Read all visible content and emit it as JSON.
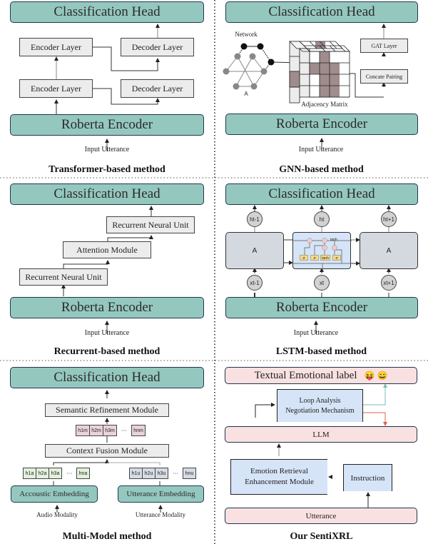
{
  "panels": {
    "transformer": {
      "head": "Classification Head",
      "encoder_layers": [
        "Encoder Layer",
        "Encoder Layer"
      ],
      "decoder_layers": [
        "Decoder Layer",
        "Decoder Layer"
      ],
      "base": "Roberta Encoder",
      "input": "Input Utterance",
      "caption": "Transformer-based method"
    },
    "gnn": {
      "head": "Classification Head",
      "network_label": "Network",
      "node_label": "A",
      "matrix_label": "Adjacency Matrix",
      "gat": "GAT Layer",
      "concat": "Concate Pairing",
      "base": "Roberta Encoder",
      "input": "Input Utterance",
      "caption": "GNN-based method"
    },
    "recurrent": {
      "head": "Classification Head",
      "top_unit": "Recurrent Neural Unit",
      "attention": "Attention Module",
      "bottom_unit": "Recurrent Neural Unit",
      "base": "Roberta Encoder",
      "input": "Input Utterance",
      "caption": "Recurrent-based method"
    },
    "lstm": {
      "head": "Classification Head",
      "outputs": [
        "ht-1",
        "ht",
        "ht+1"
      ],
      "cells": [
        "A",
        "",
        "A"
      ],
      "gates": [
        "σ",
        "σ",
        "tanh",
        "σ"
      ],
      "tanh_label": "tanh",
      "inputs": [
        "xt-1",
        "xt",
        "xt+1"
      ],
      "base": "Roberta Encoder",
      "input": "Input Utterance",
      "caption": "LSTM-based method"
    },
    "multimodal": {
      "head": "Classification Head",
      "semantic": "Semantic Refinement Module",
      "fused_tokens": [
        "h1m",
        "h2m",
        "h3m",
        "···",
        "hnm"
      ],
      "context": "Context Fusion Module",
      "audio_tokens": [
        "h1a",
        "h2a",
        "h3a",
        "···",
        "hna"
      ],
      "utter_tokens": [
        "h1u",
        "h2u",
        "h3u",
        "···",
        "hnu"
      ],
      "audio_embed": "Accoustic Embedding",
      "utter_embed": "Utterance Embedding",
      "audio_input": "Audio Modality",
      "utter_input": "Utterance Modality",
      "caption": "Multi-Model method"
    },
    "sentixrl": {
      "output": "Textual Emotional label",
      "emojis": [
        "😝",
        "😄"
      ],
      "loop": [
        "Loop Analysis",
        "Negotiation Mechanism"
      ],
      "llm": "LLM",
      "retrieval": [
        "Emotion Retrieval",
        "Enhancement Module"
      ],
      "instruction": "Instruction",
      "utterance": "Utterance",
      "caption": "Our SentiXRL",
      "accept_color": "#7fb8b4",
      "reject_color": "#e06050"
    }
  }
}
